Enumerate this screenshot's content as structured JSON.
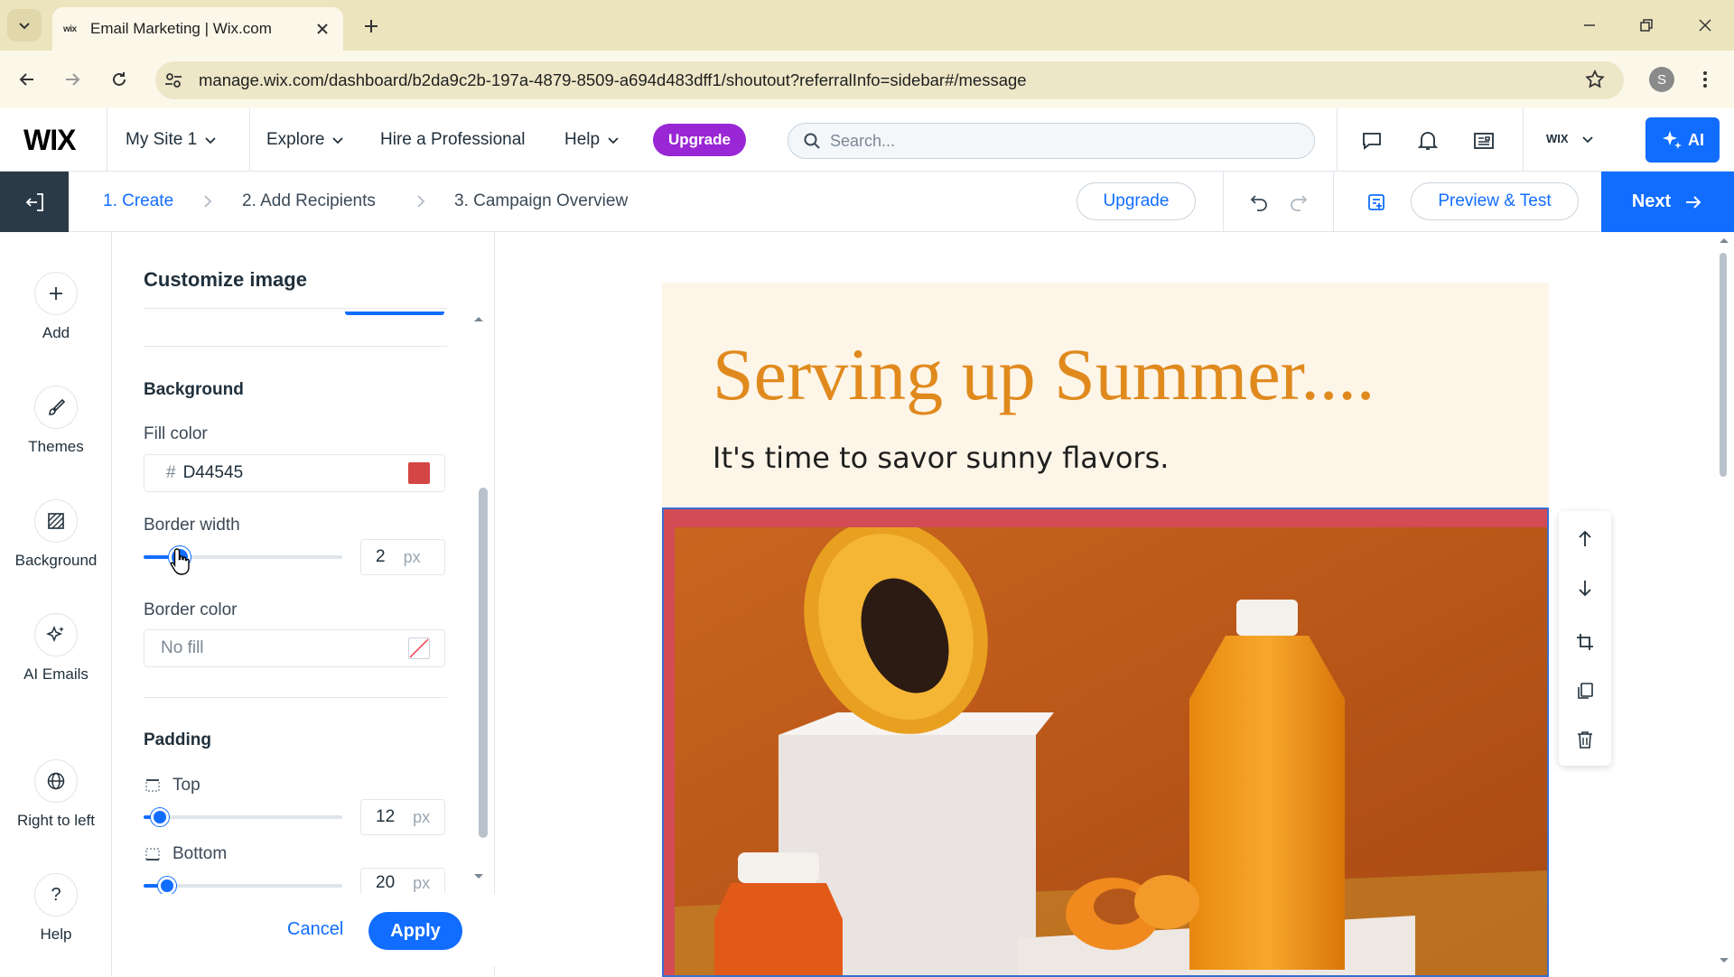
{
  "browser": {
    "tab_title": "Email Marketing | Wix.com",
    "tab_favicon": "wix",
    "url": "manage.wix.com/dashboard/b2da9c2b-197a-4879-8509-a694d483dff1/shoutout?referralInfo=sidebar#/message",
    "profile_initial": "S"
  },
  "topbar": {
    "logo": "WIX",
    "site": "My Site 1",
    "explore": "Explore",
    "hire": "Hire a Professional",
    "help": "Help",
    "upgrade": "Upgrade",
    "search_placeholder": "Search...",
    "account": "WIX",
    "ai": "AI"
  },
  "editor": {
    "steps": [
      "1. Create",
      "2. Add Recipients",
      "3. Campaign Overview"
    ],
    "upgrade": "Upgrade",
    "preview": "Preview & Test",
    "next": "Next"
  },
  "rail": {
    "items": [
      {
        "label": "Add",
        "icon": "plus-icon"
      },
      {
        "label": "Themes",
        "icon": "brush-icon"
      },
      {
        "label": "Background",
        "icon": "background-pattern-icon"
      },
      {
        "label": "AI Emails",
        "icon": "sparkle-icon"
      },
      {
        "label": "Right to left",
        "icon": "globe-icon"
      },
      {
        "label": "Help",
        "icon": "question-icon"
      }
    ]
  },
  "panel": {
    "title": "Customize image",
    "background": {
      "heading": "Background",
      "fill_label": "Fill color",
      "fill_hash": "#",
      "fill_value": "D44545",
      "fill_swatch": "#d44545",
      "border_width_label": "Border width",
      "border_width_value": "2",
      "border_width_unit": "px",
      "border_width_level": 0.18,
      "border_color_label": "Border color",
      "border_color_value": "No fill"
    },
    "padding": {
      "heading": "Padding",
      "top_label": "Top",
      "top_value": "12",
      "top_unit": "px",
      "top_level": 0.08,
      "bottom_label": "Bottom",
      "bottom_value": "20",
      "bottom_unit": "px",
      "bottom_level": 0.12
    },
    "cancel": "Cancel",
    "apply": "Apply"
  },
  "email": {
    "headline": "Serving up Summer....",
    "subline": "It's time to savor sunny flavors.",
    "header_bg": "#fdf5e7",
    "headline_color": "#e08a1e",
    "image_border_color": "#d24b55"
  },
  "colors": {
    "accent": "#116dff",
    "upgrade_purple": "#9a27d5",
    "dark_rail": "#2b3a47"
  }
}
